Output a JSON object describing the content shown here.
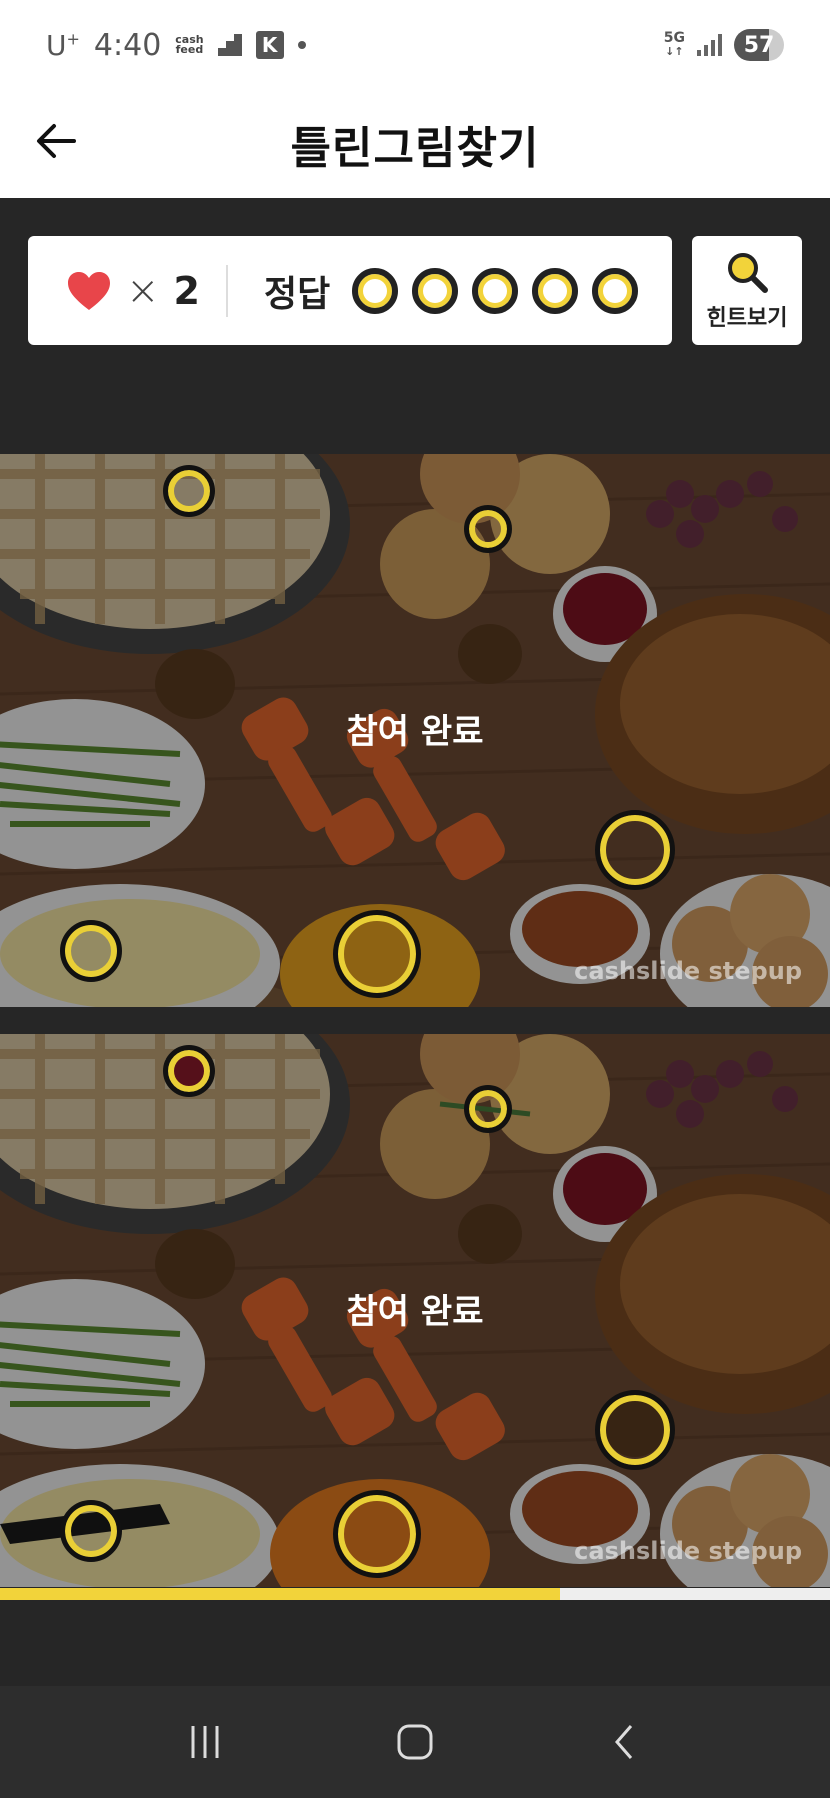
{
  "status_bar": {
    "carrier": "U",
    "carrier_sup": "+",
    "time": "4:40",
    "cashfeed_line1": "cash",
    "cashfeed_line2": "feed",
    "k_icon": "K",
    "network_top": "5G",
    "battery": "57"
  },
  "app_bar": {
    "title": "틀린그림찾기",
    "back_icon": "arrow-left-icon"
  },
  "info": {
    "lives_times": "×",
    "lives_count": "2",
    "answers_label": "정답",
    "answers_total": 5,
    "answers_found": 5,
    "hint_label": "힌트보기"
  },
  "images": {
    "done_label": "참여 완료",
    "watermark": "cashslide stepup"
  },
  "progress": {
    "fraction": 0.675
  },
  "colors": {
    "accent": "#f2d33a",
    "heart": "#e8454a",
    "background": "#262626"
  }
}
